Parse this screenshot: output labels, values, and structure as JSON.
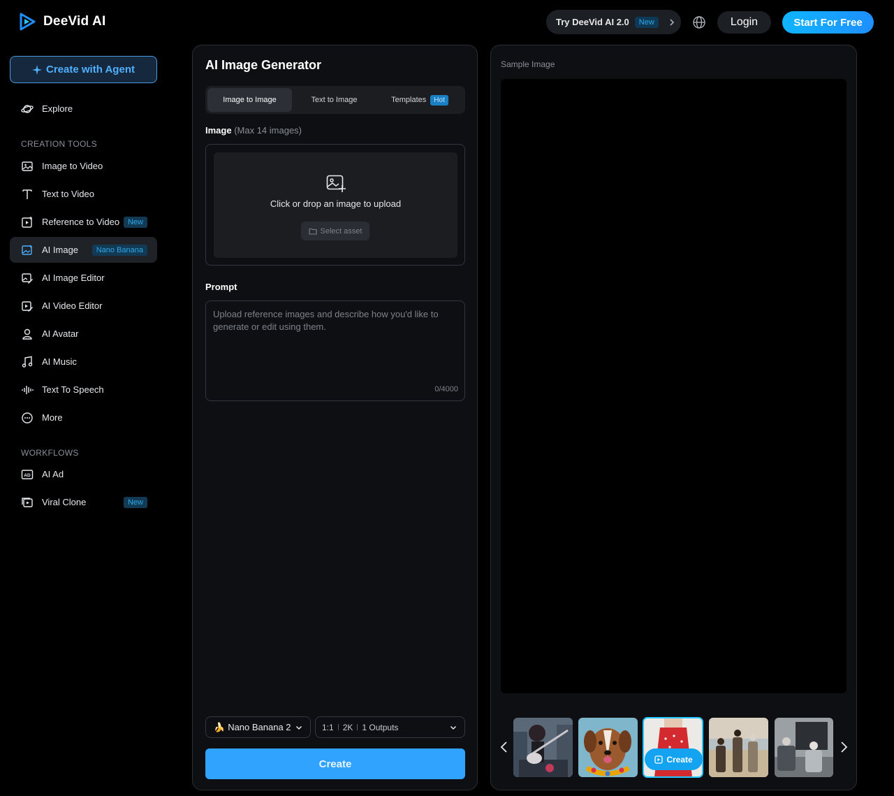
{
  "header": {
    "brand": "DeeVid AI",
    "try_label": "Try DeeVid AI 2.0",
    "try_badge": "New",
    "login_label": "Login",
    "start_label": "Start For Free"
  },
  "sidebar": {
    "agent_label": "Create with Agent",
    "explore_label": "Explore",
    "creation_title": "CREATION TOOLS",
    "creation_items": [
      {
        "label": "Image to Video",
        "icon": "image-icon"
      },
      {
        "label": "Text to Video",
        "icon": "text-icon"
      },
      {
        "label": "Reference to Video",
        "icon": "reference-icon",
        "badge": "New"
      },
      {
        "label": "AI Image",
        "icon": "ai-image-icon",
        "badge": "Nano Banana",
        "active": true
      },
      {
        "label": "AI Image Editor",
        "icon": "image-editor-icon"
      },
      {
        "label": "AI Video Editor",
        "icon": "video-editor-icon"
      },
      {
        "label": "AI Avatar",
        "icon": "avatar-icon"
      },
      {
        "label": "AI Music",
        "icon": "music-icon"
      },
      {
        "label": "Text To Speech",
        "icon": "waveform-icon"
      },
      {
        "label": "More",
        "icon": "more-icon"
      }
    ],
    "workflows_title": "WORKFLOWS",
    "workflow_items": [
      {
        "label": "AI Ad",
        "icon": "ad-icon"
      },
      {
        "label": "Viral Clone",
        "icon": "clone-icon",
        "badge": "New"
      }
    ]
  },
  "generator": {
    "title": "AI Image Generator",
    "tabs": [
      {
        "label": "Image to Image",
        "active": true
      },
      {
        "label": "Text to Image"
      },
      {
        "label": "Templates",
        "badge": "Hot"
      }
    ],
    "image_label": "Image",
    "image_hint": "(Max 14 images)",
    "upload_text": "Click or drop an image to upload",
    "select_asset": "Select asset",
    "prompt_label": "Prompt",
    "prompt_placeholder": "Upload reference images and describe how you'd like to generate or edit using them.",
    "char_count": "0/4000",
    "model": "Nano Banana 2",
    "model_icon": "🍌",
    "ratio": "1:1",
    "resolution": "2K",
    "outputs": "1 Outputs",
    "create_label": "Create"
  },
  "sample": {
    "label": "Sample Image",
    "create_overlay": "Create",
    "thumbnails": [
      "anime-guitarist",
      "dog-with-flower-lei",
      "woman-red-polka-dress",
      "people-on-beach",
      "people-at-computer"
    ],
    "selected_index": 2
  },
  "colors": {
    "accent": "#2fa3ff",
    "cyan": "#22c8ff",
    "background": "#000000",
    "panel": "#0e0f12"
  }
}
